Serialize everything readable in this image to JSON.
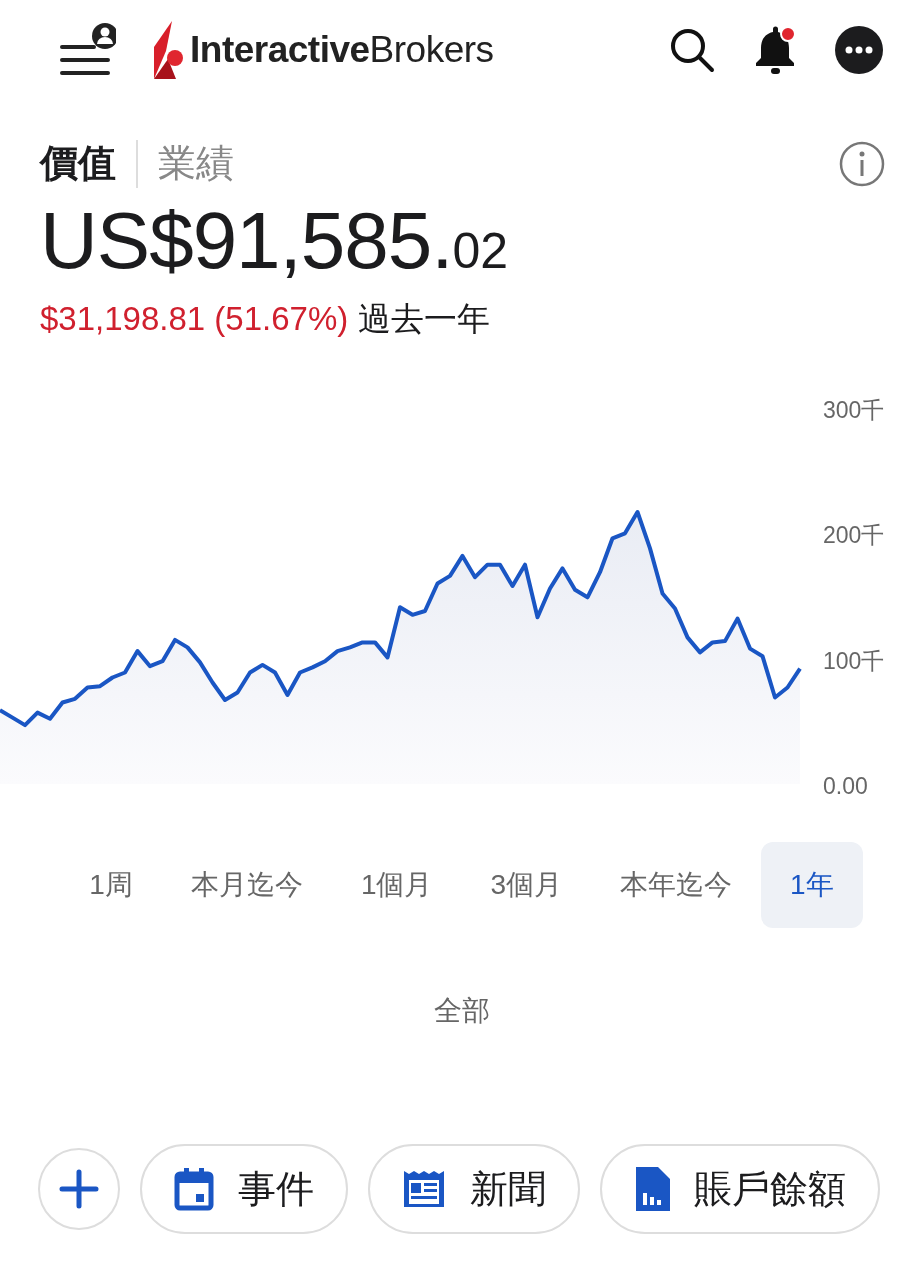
{
  "header": {
    "logo": "**Interactive**Brokers"
  },
  "view_tabs": [
    {
      "label": "價值",
      "selected": true
    },
    {
      "label": "業績",
      "selected": false
    }
  ],
  "balance": {
    "main": "US$91,585.",
    "cents": "02"
  },
  "change": {
    "amount": "$31,198.81 (51.67%)",
    "period": "過去一年"
  },
  "chart_data": {
    "type": "area",
    "ylim": [
      0,
      300
    ],
    "yticks": [
      {
        "value": 0,
        "label": "0.00"
      },
      {
        "value": 100,
        "label": "100千"
      },
      {
        "value": 200,
        "label": "200千"
      },
      {
        "value": 300,
        "label": "300千"
      }
    ],
    "series": [
      {
        "color": "#1a56c4",
        "values": [
          59,
          53,
          47,
          57,
          52,
          65,
          68,
          77,
          78,
          85,
          89,
          106,
          94,
          98,
          115,
          109,
          97,
          81,
          67,
          73,
          89,
          95,
          89,
          71,
          89,
          93,
          98,
          106,
          109,
          113,
          113,
          101,
          141,
          135,
          138,
          160,
          166,
          182,
          165,
          175,
          175,
          158,
          175,
          133,
          156,
          172,
          155,
          149,
          169,
          196,
          200,
          217,
          188,
          152,
          140,
          117,
          105,
          113,
          114,
          132,
          108,
          102,
          69,
          77,
          92
        ]
      }
    ]
  },
  "ranges": [
    {
      "label": "1周",
      "selected": false
    },
    {
      "label": "本月迄今",
      "selected": false
    },
    {
      "label": "1個月",
      "selected": false
    },
    {
      "label": "3個月",
      "selected": false
    },
    {
      "label": "本年迄今",
      "selected": false
    },
    {
      "label": "1年",
      "selected": true
    },
    {
      "label": "全部",
      "selected": false
    }
  ],
  "actions": [
    {
      "kind": "add"
    },
    {
      "kind": "calendar",
      "label": "事件"
    },
    {
      "kind": "news",
      "label": "新聞"
    },
    {
      "kind": "document",
      "label": "賬戶餘額"
    }
  ]
}
